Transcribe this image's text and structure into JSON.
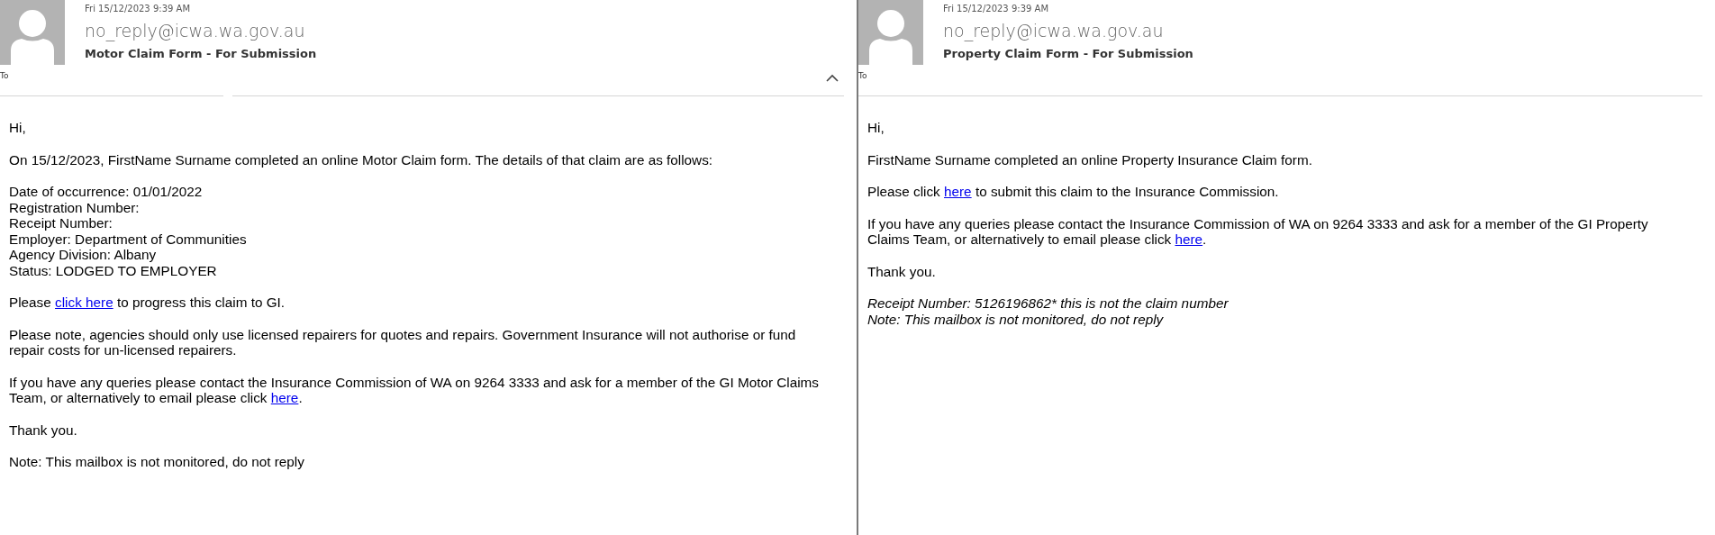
{
  "panes": [
    {
      "received": "Fri 15/12/2023 9:39 AM",
      "sender": "no_reply@icwa.wa.gov.au",
      "subject": "Motor Claim Form - For Submission",
      "to_label": "To",
      "collapsible": true,
      "paragraphs": [
        {
          "italic": false,
          "lines": [
            [
              {
                "kind": "text",
                "text": "Hi,"
              }
            ]
          ]
        },
        {
          "italic": false,
          "lines": [
            [
              {
                "kind": "text",
                "text": "On 15/12/2023, FirstName Surname completed an online Motor Claim form. The details of that claim are as follows:"
              }
            ]
          ]
        },
        {
          "italic": false,
          "lines": [
            [
              {
                "kind": "text",
                "text": "Date of occurrence: 01/01/2022"
              }
            ],
            [
              {
                "kind": "text",
                "text": "Registration Number:"
              }
            ],
            [
              {
                "kind": "text",
                "text": "Receipt Number:"
              }
            ],
            [
              {
                "kind": "text",
                "text": "Employer: Department of Communities"
              }
            ],
            [
              {
                "kind": "text",
                "text": "Agency Division: Albany"
              }
            ],
            [
              {
                "kind": "text",
                "text": "Status: LODGED TO EMPLOYER"
              }
            ]
          ]
        },
        {
          "italic": false,
          "lines": [
            [
              {
                "kind": "text",
                "text": "Please "
              },
              {
                "kind": "link",
                "text": "click here"
              },
              {
                "kind": "text",
                "text": " to progress this claim to GI."
              }
            ]
          ]
        },
        {
          "italic": false,
          "lines": [
            [
              {
                "kind": "text",
                "text": "Please note, agencies should only use licensed repairers for quotes and repairs. Government Insurance will not authorise or fund repair costs for un-licensed repairers."
              }
            ]
          ]
        },
        {
          "italic": false,
          "lines": [
            [
              {
                "kind": "text",
                "text": "If you have any queries please contact the Insurance Commission of WA on 9264 3333 and ask for a member of the GI Motor Claims Team, or alternatively to email please click "
              },
              {
                "kind": "link",
                "text": "here"
              },
              {
                "kind": "text",
                "text": "."
              }
            ]
          ]
        },
        {
          "italic": false,
          "lines": [
            [
              {
                "kind": "text",
                "text": "Thank you."
              }
            ]
          ]
        },
        {
          "italic": false,
          "lines": [
            [
              {
                "kind": "text",
                "text": "Note: This mailbox is not monitored, do not reply"
              }
            ]
          ]
        }
      ]
    },
    {
      "received": "Fri 15/12/2023 9:39 AM",
      "sender": "no_reply@icwa.wa.gov.au",
      "subject": "Property Claim Form - For Submission",
      "to_label": "To",
      "collapsible": false,
      "paragraphs": [
        {
          "italic": false,
          "lines": [
            [
              {
                "kind": "text",
                "text": "Hi,"
              }
            ]
          ]
        },
        {
          "italic": false,
          "lines": [
            [
              {
                "kind": "text",
                "text": "FirstName Surname completed an online Property Insurance Claim form."
              }
            ]
          ]
        },
        {
          "italic": false,
          "lines": [
            [
              {
                "kind": "text",
                "text": "Please click "
              },
              {
                "kind": "link",
                "text": "here"
              },
              {
                "kind": "text",
                "text": " to submit this claim to the Insurance Commission."
              }
            ]
          ]
        },
        {
          "italic": false,
          "lines": [
            [
              {
                "kind": "text",
                "text": "If you have any queries please contact the Insurance Commission of WA on 9264 3333 and ask for a member of the GI Property Claims Team, or alternatively to email please click "
              },
              {
                "kind": "link",
                "text": "here"
              },
              {
                "kind": "text",
                "text": "."
              }
            ]
          ]
        },
        {
          "italic": false,
          "lines": [
            [
              {
                "kind": "text",
                "text": "Thank you."
              }
            ]
          ]
        },
        {
          "italic": true,
          "lines": [
            [
              {
                "kind": "text",
                "text": "Receipt Number: 5126196862* this is not the claim number"
              }
            ],
            [
              {
                "kind": "text",
                "text": "Note: This mailbox is not monitored, do not reply"
              }
            ]
          ]
        }
      ]
    }
  ]
}
